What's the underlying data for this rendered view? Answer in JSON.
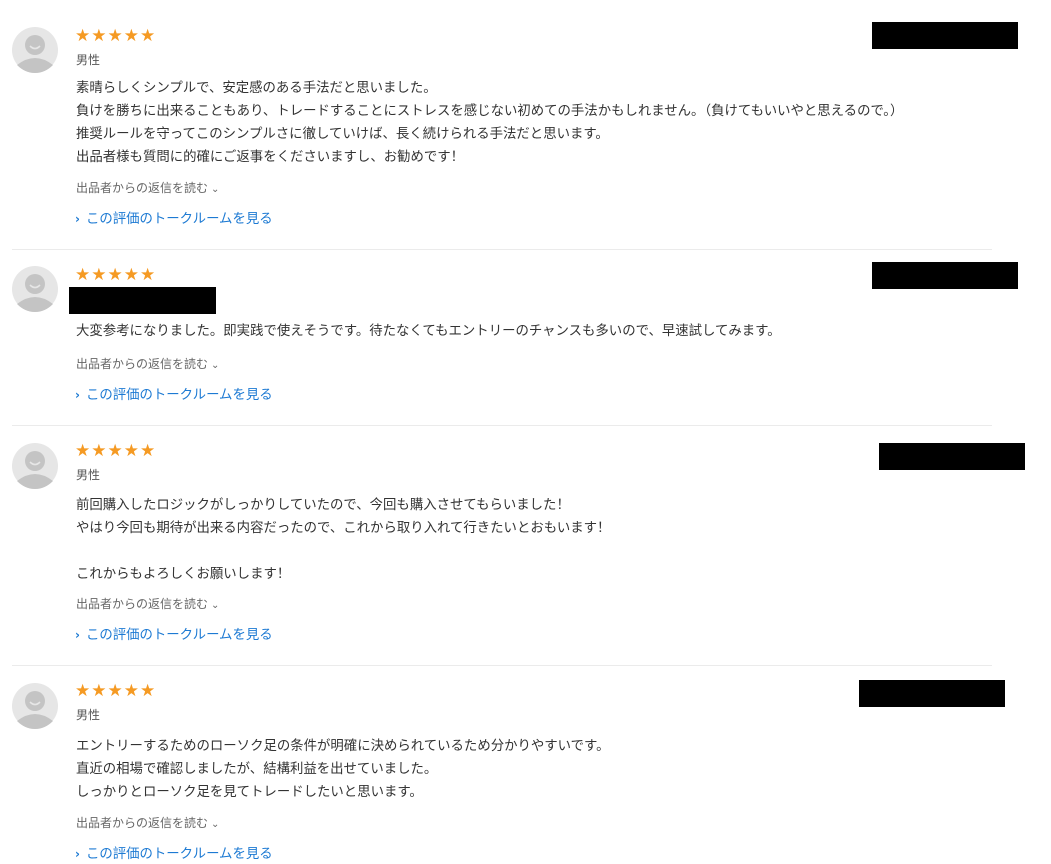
{
  "icons": {
    "avatar": "user-avatar-icon",
    "star": "star-icon",
    "chevron_down": "chevron-down-icon",
    "chevron_right": "chevron-right-icon"
  },
  "colors": {
    "star": "#f59a23",
    "link": "#1d7ad3",
    "redaction": "#000000"
  },
  "labels": {
    "reply_toggle": "出品者からの返信を読む",
    "talk_room": "この評価のトークルームを見る"
  },
  "reviews": [
    {
      "rating": 5,
      "stars": "★★★★★",
      "gender": "男性",
      "body": "素晴らしくシンプルで、安定感のある手法だと思いました。\n負けを勝ちに出来ることもあり、トレードすることにストレスを感じない初めての手法かもしれません。（負けてもいいやと思えるので。）\n推奨ルールを守ってこのシンプルさに徹していけば、長く続けられる手法だと思います。\n出品者様も質問に的確にご返事をくださいますし、お勧めです！"
    },
    {
      "rating": 5,
      "stars": "★★★★★",
      "gender": "",
      "body": "大変参考になりました。即実践で使えそうです。待たなくてもエントリーのチャンスも多いので、早速試してみます。"
    },
    {
      "rating": 5,
      "stars": "★★★★★",
      "gender": "男性",
      "body": "前回購入したロジックがしっかりしていたので、今回も購入させてもらいました！\nやはり今回も期待が出来る内容だったので、これから取り入れて行きたいとおもいます！\n\nこれからもよろしくお願いします！"
    },
    {
      "rating": 5,
      "stars": "★★★★★",
      "gender": "男性",
      "body": "エントリーするためのローソク足の条件が明確に決められているため分かりやすいです。\n直近の相場で確認しましたが、結構利益を出せていました。\nしっかりとローソク足を見てトレードしたいと思います。"
    }
  ]
}
